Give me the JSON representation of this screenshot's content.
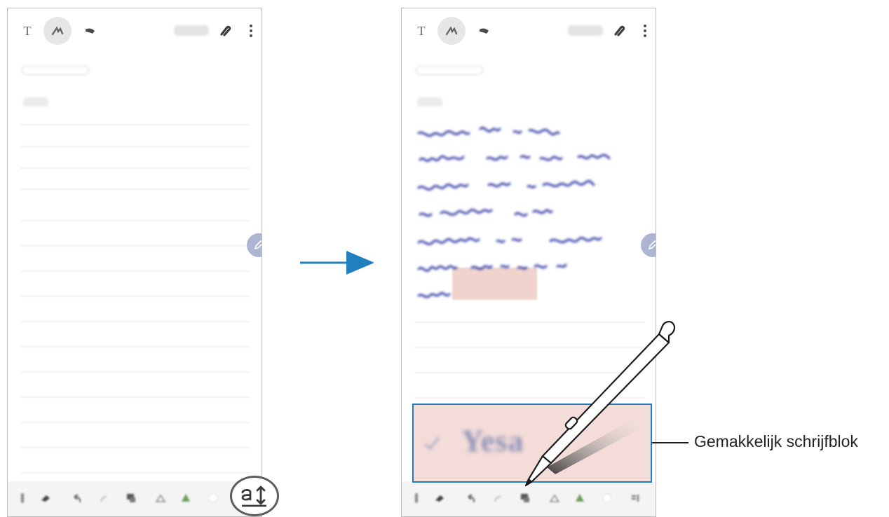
{
  "callout": {
    "label": "Gemakkelijk schrijfblok"
  },
  "toolbar": {
    "text_icon_glyph": "T"
  },
  "easy_pad": {
    "word": "Yesa"
  },
  "icons": [
    "text-mode-icon",
    "pen-mode-icon",
    "brush-mode-icon",
    "attach-icon",
    "more-options-icon",
    "edit-fab-icon",
    "pen-settings-icon",
    "eraser-icon",
    "undo-icon",
    "redo-icon",
    "select-icon",
    "shape-icon",
    "color-icon",
    "easy-writing-pad-icon",
    "s-pen-icon",
    "arrow-right-icon"
  ],
  "colors": {
    "callout_border": "#1f7fbf",
    "arrow": "#1f7fbf",
    "pad_background": "#f4dcd8",
    "fab": "#aeb5d3",
    "handwriting_ink": "#3b43a8"
  }
}
